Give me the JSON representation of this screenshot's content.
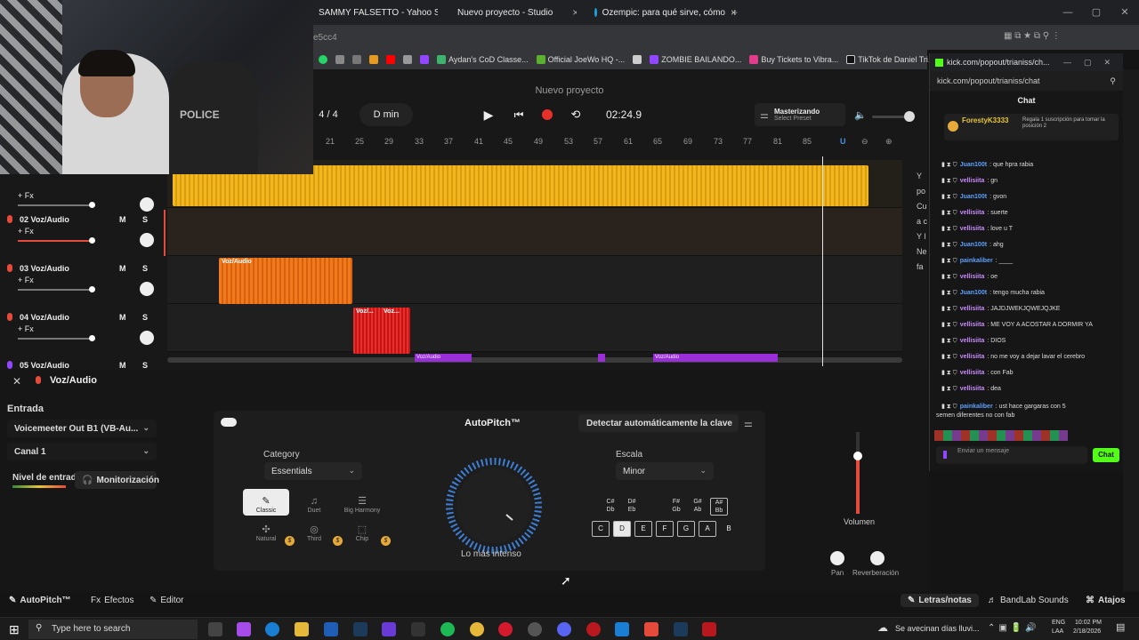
{
  "browser": {
    "tabs": [
      {
        "label": "SAMMY FALSETTO - Yahoo Sea",
        "color": "#7b3fe4"
      },
      {
        "label": "Nuevo proyecto - Studio",
        "color": "#e23d3d"
      },
      {
        "label": "Ozempic: para qué sirve, cómo",
        "color": "#1ba0e0"
      }
    ],
    "url_fragment": "e5cc4",
    "bookmarks": [
      "Aydan's CoD Classe...",
      "Official JoeWo HQ -...",
      "ZOMBIE BAILANDO...",
      "Buy Tickets to Vibra...",
      "TikTok de Daniel Tri..."
    ]
  },
  "studio": {
    "project_title": "Nuevo proyecto",
    "time_signature": "4 / 4",
    "key": "D min",
    "time": "02:24.9",
    "mastering_title": "Masterizando",
    "mastering_sub": "Select Preset",
    "ruler": [
      "21",
      "25",
      "29",
      "33",
      "37",
      "41",
      "45",
      "49",
      "53",
      "57",
      "61",
      "65",
      "69",
      "73",
      "77",
      "81",
      "85"
    ],
    "tracks": [
      {
        "name": "",
        "fx": "+ Fx",
        "ms": "",
        "level": 0.42
      },
      {
        "name": "02  Voz/Audio",
        "fx": "+ Fx",
        "ms": "M S",
        "level": 0.42
      },
      {
        "name": "03  Voz/Audio",
        "fx": "+ Fx",
        "ms": "M S",
        "level": 0.42
      },
      {
        "name": "04  Voz/Audio",
        "fx": "+ Fx",
        "ms": "M S",
        "level": 0.42
      },
      {
        "name": "05  Voz/Audio",
        "fx": "",
        "ms": "M S",
        "level": 0.42
      }
    ],
    "clips": [
      "Voz/Audio",
      "Voz/...",
      "Voz...",
      "Voz/Audio",
      "Voz/Audio"
    ]
  },
  "panel": {
    "track_title": "Voz/Audio",
    "entrada_label": "Entrada",
    "input_device": "Voicemeeter Out B1 (VB-Au...",
    "channel": "Canal 1",
    "nivel_label": "Nivel de entrada",
    "monitor_label": "Monitorización",
    "autopitch_title": "AutoPitch™",
    "detect_key": "Detectar automáticamente la clave",
    "category_label": "Category",
    "category_value": "Essentials",
    "styles": [
      "Classic",
      "Duet",
      "Big Harmony",
      "Natural",
      "Third",
      "Chip"
    ],
    "intensity_label": "Lo más intenso",
    "escala_label": "Escala",
    "escala_value": "Minor",
    "sharps": [
      "C#\nDb",
      "D#\nEb",
      "F#\nGb",
      "G#\nAb",
      "A#\nBb"
    ],
    "naturals": [
      "C",
      "D",
      "E",
      "F",
      "G",
      "A",
      "B"
    ],
    "volume_label": "Volumen",
    "volume_level": 0.7,
    "pan_label": "Pan",
    "reverb_label": "Reverberación"
  },
  "bottom": {
    "autopitch": "AutoPitch™",
    "efectos": "Efectos",
    "editor": "Editor",
    "letras": "Letras/notas",
    "bandlab": "BandLab Sounds",
    "atajos": "Atajos"
  },
  "kick": {
    "window_title": "kick.com/popout/trianiss/ch...",
    "url": "kick.com/popout/trianiss/chat",
    "chat_title": "Chat",
    "pinned_user": "ForestyK3333",
    "pinned_note": "Regala 1 suscripción para tomar la posición 2",
    "messages": [
      {
        "user": "Juan100t",
        "text": ": que hpra rabia",
        "color": "#5aa0ff"
      },
      {
        "user": "vellisiita",
        "text": ": gn",
        "color": "#c98aff"
      },
      {
        "user": "Juan100t",
        "text": ": gvon",
        "color": "#5aa0ff"
      },
      {
        "user": "vellisiita",
        "text": ": suerte",
        "color": "#c98aff"
      },
      {
        "user": "vellisiita",
        "text": ": love u T",
        "color": "#c98aff"
      },
      {
        "user": "Juan100t",
        "text": ": ahg",
        "color": "#5aa0ff"
      },
      {
        "user": "painkaliber",
        "text": ": ____",
        "color": "#5aa0ff"
      },
      {
        "user": "vellisiita",
        "text": ": oe",
        "color": "#c98aff"
      },
      {
        "user": "Juan100t",
        "text": ": tengo mucha rabia",
        "color": "#5aa0ff"
      },
      {
        "user": "vellisiita",
        "text": ": JAJDJWEKJQWEJQJKE",
        "color": "#c98aff"
      },
      {
        "user": "vellisiita",
        "text": ": ME VOY A ACOSTAR A DORMIR YA",
        "color": "#c98aff"
      },
      {
        "user": "vellisiita",
        "text": ": DIOS",
        "color": "#c98aff"
      },
      {
        "user": "vellisiita",
        "text": ": no me voy a dejar lavar el cerebro",
        "color": "#c98aff"
      },
      {
        "user": "vellisiita",
        "text": ": con Fab",
        "color": "#c98aff"
      },
      {
        "user": "vellisiita",
        "text": ": dea",
        "color": "#c98aff"
      },
      {
        "user": "painkaliber",
        "text": ": ust hace gargaras con 5",
        "color": "#5aa0ff"
      }
    ],
    "last_line": "semen diferentes no con fab",
    "send_placeholder": "Enviar un mensaje",
    "chat_button": "Chat"
  },
  "taskbar": {
    "search_placeholder": "Type here to search",
    "weather": "Se avecinan días lluvi...",
    "lang": "ENG",
    "region": "LAA",
    "time": "10:02 PM",
    "date": "2/18/2026"
  }
}
